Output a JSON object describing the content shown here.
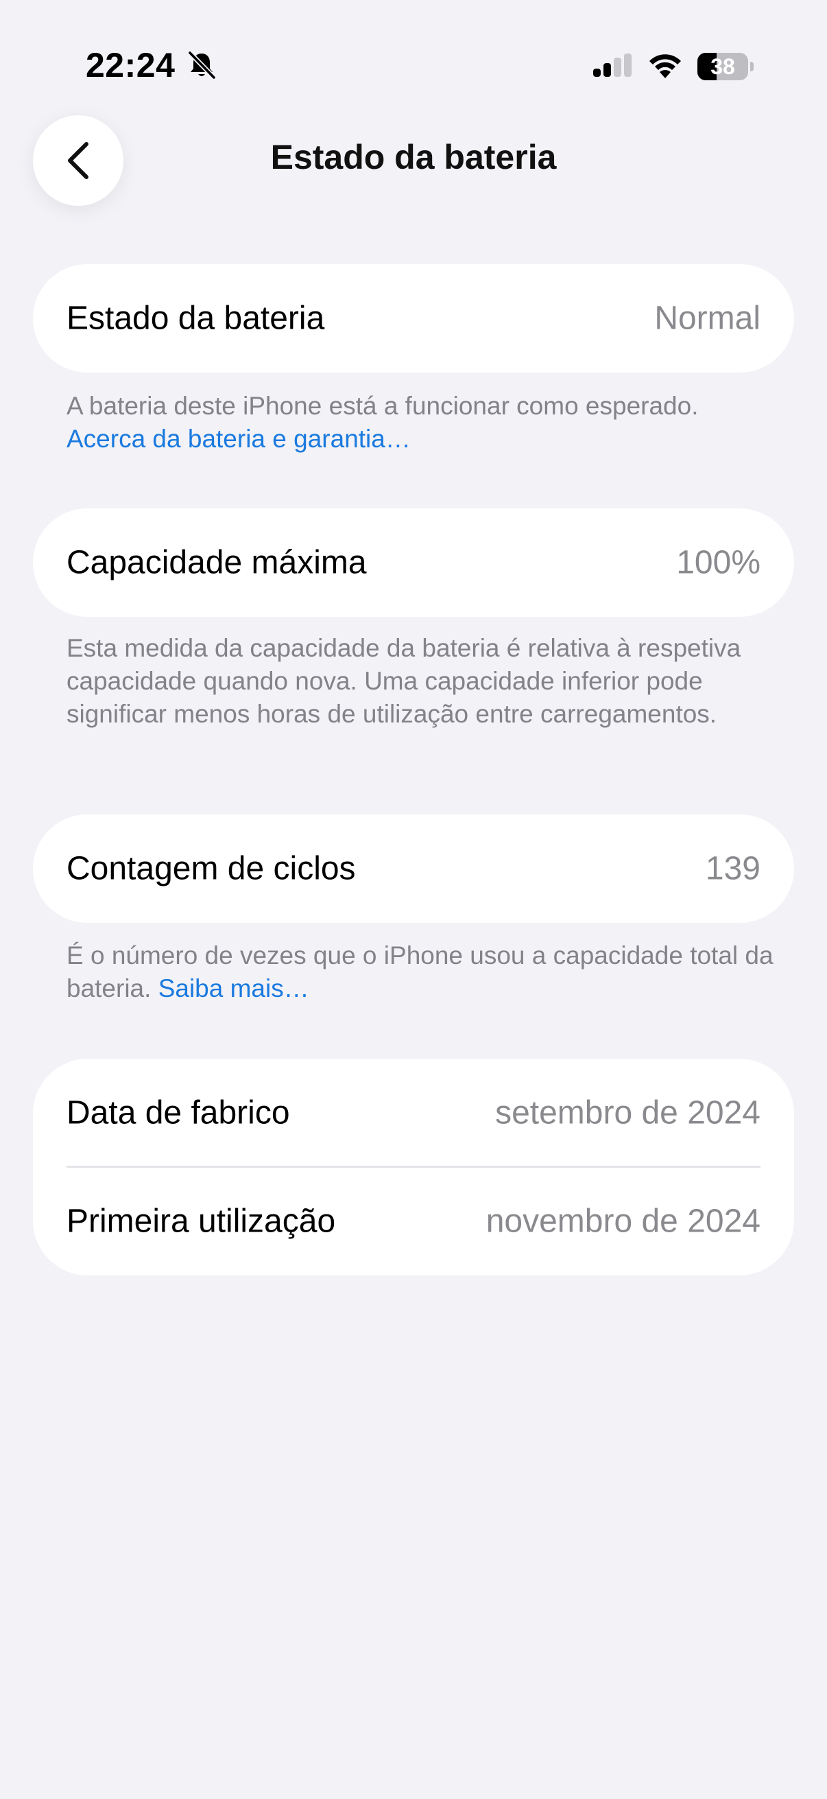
{
  "status_bar": {
    "time": "22:24",
    "battery_level": "38",
    "battery_fraction": 0.38,
    "icons": [
      "bell-slash-icon",
      "cellular-signal-icon",
      "wifi-icon",
      "battery-icon"
    ]
  },
  "nav": {
    "title": "Estado da bateria",
    "back_icon": "chevron-left-icon"
  },
  "sections": {
    "health": {
      "label": "Estado da bateria",
      "value": "Normal",
      "footnote_text": "A bateria deste iPhone está a funcionar como esperado. ",
      "footnote_link": "Acerca da bateria e garantia…"
    },
    "capacity": {
      "label": "Capacidade máxima",
      "value": "100%",
      "footnote_text": "Esta medida da capacidade da bateria é relativa à respetiva capacidade quando nova. Uma capacidade inferior pode significar menos horas de utilização entre carregamentos."
    },
    "cycles": {
      "label": "Contagem de ciclos",
      "value": "139",
      "footnote_text": "É o número de vezes que o iPhone usou a capacidade total da bateria. ",
      "footnote_link": "Saiba mais…"
    },
    "dates": {
      "manufacture_label": "Data de fabrico",
      "manufacture_value": "setembro de 2024",
      "first_use_label": "Primeira utilização",
      "first_use_value": "novembro de 2024"
    }
  },
  "colors": {
    "background": "#f2f2f7",
    "card": "#ffffff",
    "secondary_text": "#8a8a8e",
    "link": "#1a7adf"
  }
}
